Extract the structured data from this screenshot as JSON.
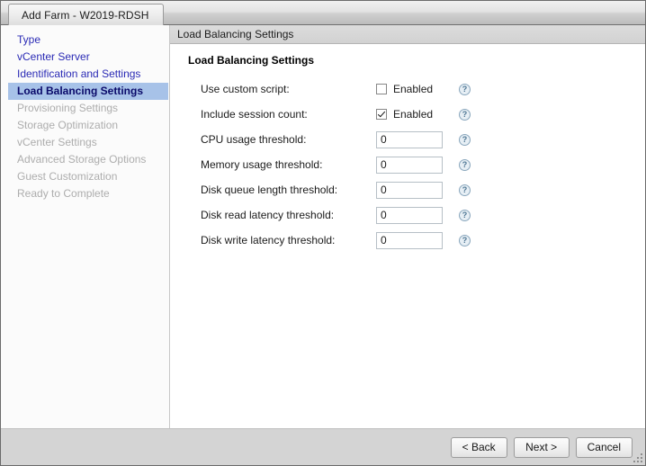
{
  "window": {
    "title": "Add Farm - W2019-RDSH"
  },
  "sidebar": {
    "items": [
      {
        "label": "Type",
        "state": "done"
      },
      {
        "label": "vCenter Server",
        "state": "done"
      },
      {
        "label": "Identification and Settings",
        "state": "done"
      },
      {
        "label": "Load Balancing Settings",
        "state": "selected"
      },
      {
        "label": "Provisioning Settings",
        "state": "pending"
      },
      {
        "label": "Storage Optimization",
        "state": "pending"
      },
      {
        "label": "vCenter Settings",
        "state": "pending"
      },
      {
        "label": "Advanced Storage Options",
        "state": "pending"
      },
      {
        "label": "Guest Customization",
        "state": "pending"
      },
      {
        "label": "Ready to Complete",
        "state": "pending"
      }
    ]
  },
  "content": {
    "header": "Load Balancing Settings",
    "section_title": "Load Balancing Settings",
    "help_glyph": "?",
    "rows": [
      {
        "label": "Use custom script:",
        "type": "checkbox",
        "checkbox_label": "Enabled",
        "checked": false
      },
      {
        "label": "Include session count:",
        "type": "checkbox",
        "checkbox_label": "Enabled",
        "checked": true
      },
      {
        "label": "CPU usage threshold:",
        "type": "input",
        "value": "0"
      },
      {
        "label": "Memory usage threshold:",
        "type": "input",
        "value": "0"
      },
      {
        "label": "Disk queue length threshold:",
        "type": "input",
        "value": "0"
      },
      {
        "label": "Disk read latency threshold:",
        "type": "input",
        "value": "0"
      },
      {
        "label": "Disk write latency threshold:",
        "type": "input",
        "value": "0"
      }
    ]
  },
  "footer": {
    "back_label": "< Back",
    "next_label": "Next >",
    "cancel_label": "Cancel"
  },
  "colors": {
    "link": "#2a2ab5",
    "selected_bg": "#a7c2e8",
    "disabled_text": "#adadad",
    "chrome": "#d4d4d4"
  }
}
